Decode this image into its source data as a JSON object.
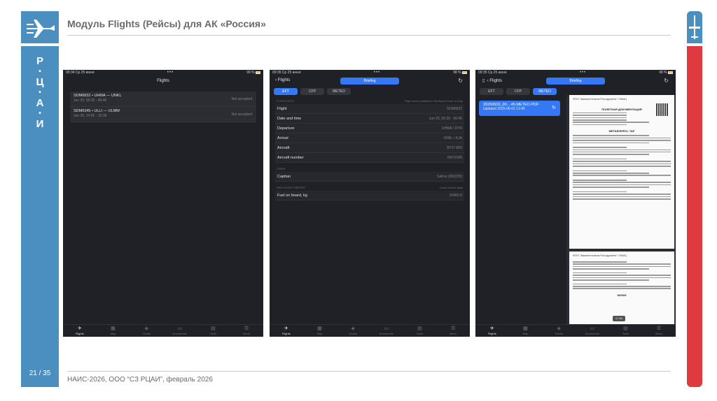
{
  "slide": {
    "title": "Модуль Flights (Рейсы) для АК «Россия»",
    "vertical_letters": [
      "Р",
      "Ц",
      "А",
      "И"
    ],
    "page_number": "21 / 35",
    "footer": "НАИС-2026, ООО “СЗ РЦАИ”,  февраль 2026",
    "colors": {
      "left_bar": "#4a8fbf",
      "right_bar": "#de3b40",
      "accent": "#3478f6"
    }
  },
  "tabbar": [
    {
      "label": "Flights",
      "icon": "plane-icon"
    },
    {
      "label": "Map",
      "icon": "map-icon"
    },
    {
      "label": "Charts",
      "icon": "chart-icon"
    },
    {
      "label": "Documents",
      "icon": "folder-icon"
    },
    {
      "label": "Tools",
      "icon": "tools-icon"
    },
    {
      "label": "Menu",
      "icon": "menu-icon"
    }
  ],
  "screen1": {
    "status_time": "09:34  Ср 25 июня",
    "status_right": "99 %",
    "nav_title": "Flights",
    "flights": [
      {
        "title": "SDM6832 • UHMA — UNKL",
        "subtitle": "Jun 25, 00:30 - 06:46",
        "status": "Not accepted"
      },
      {
        "title": "SDM6345 • ULLI — ULMM",
        "subtitle": "Jun 25, 14:55 - 16:38",
        "status": "Not accepted"
      }
    ]
  },
  "screen2": {
    "status_time": "09:35  Ср 25 июня",
    "status_right": "98 %",
    "back_label": "Flights",
    "briefing_label": "Briefing",
    "tabs": [
      "EFT",
      "CFP",
      "METEO"
    ],
    "flight_info_header": "FLIGHT INFO",
    "flight_info_note": "Flight book available in the flights folder in Map",
    "flight_info": [
      {
        "label": "Flight",
        "value": "SDM6832"
      },
      {
        "label": "Date and time",
        "value": "Jun 25, 00:30 - 06:46"
      },
      {
        "label": "Departure",
        "value": "UHMA / DYR"
      },
      {
        "label": "Arrival",
        "value": "UNKL / KJA"
      },
      {
        "label": "Aircraft",
        "value": "B737-800"
      },
      {
        "label": "Aircraft number",
        "value": "RA73189"
      }
    ],
    "crew_header": "CREW",
    "crew": [
      {
        "label": "Capitan",
        "value": "Sahno (060225)"
      }
    ],
    "preflight_header": "PRE-FLIGHT REPORT",
    "preflight_note": "Check before flight",
    "preflight": [
      {
        "label": "Fuel on board, kg",
        "value": "20400.0"
      }
    ]
  },
  "screen3": {
    "status_time": "09:35  Ср 25 июня",
    "status_right": "98 %",
    "back_label": "Flights",
    "briefing_label": "Briefing",
    "tabs": [
      "EFT",
      "CFP",
      "METEO"
    ],
    "file_name": "20250603_00....45.METEO.PDF",
    "file_updated": "Updated 2025-06-02 13:45",
    "doc_header": "ФГБУ \"Авиаметтелеком Росгидромета\" / ФАМЦ",
    "doc_title": "ПОЛЕТНАЯ ДОКУМЕНТАЦИЯ",
    "doc_section": "METAR/SPECI, TAF",
    "doc_section2": "SIGWX",
    "page_indicator": "1 / 41"
  }
}
